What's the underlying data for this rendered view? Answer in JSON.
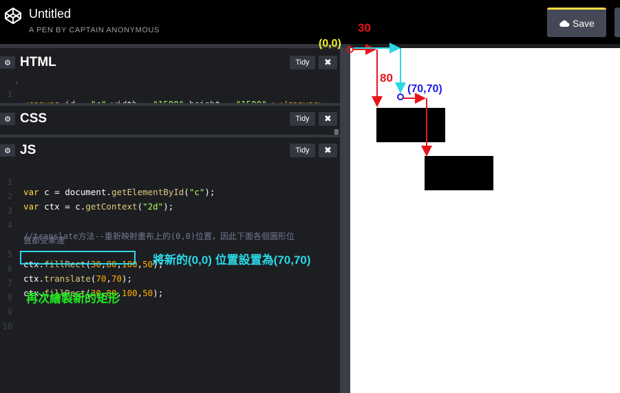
{
  "header": {
    "title": "Untitled",
    "subtitle": "A PEN BY CAPTAIN ANONYMOUS",
    "save_label": "Save",
    "logo_icon": "codepen-logo-icon",
    "save_icon": "cloud-icon"
  },
  "panels": {
    "html": {
      "name": "HTML",
      "tidy": "Tidy",
      "close": "✖"
    },
    "css": {
      "name": "CSS",
      "tidy": "Tidy",
      "close": "✖"
    },
    "js": {
      "name": "JS",
      "tidy": "Tidy",
      "close": "✖"
    }
  },
  "html_code": {
    "line_number": "1",
    "segments": [
      "<canvas ",
      "id",
      " = ",
      "\"c\"",
      " width",
      " = ",
      "\"1500\"",
      " height",
      " = ",
      "\"1500\"",
      " ></canvas>"
    ]
  },
  "js_code": {
    "line_numbers": [
      "1",
      "2",
      "3",
      "4",
      "5",
      "6",
      "7",
      "8",
      "9",
      "10"
    ],
    "line1": [
      "var",
      " c = document.",
      "getElementById",
      "(",
      "\"c\"",
      ");"
    ],
    "line2": [
      "var",
      " ctx = c.",
      "getContext",
      "(",
      "\"2d\"",
      ");"
    ],
    "line4a": "//translate方法--重新映射畫布上的(0,0)位置，因此下面各個圖形位",
    "line4b": "置都受牽連",
    "line5": [
      "ctx.",
      "fillRect",
      "(",
      "30",
      ",",
      "80",
      ",",
      "100",
      ",",
      "50",
      ");"
    ],
    "line6": [
      "ctx.",
      "translate",
      "(",
      "70",
      ",",
      "70",
      ");"
    ],
    "line7": [
      "ctx.",
      "fillRect",
      "(",
      "30",
      ",",
      "80",
      ",",
      "100",
      ",",
      "50",
      ");"
    ]
  },
  "annotations": {
    "translate_note": "將新的(0,0) 位置設置為(70,70)",
    "redraw_note": "再次繪製新的矩形",
    "origin_label": "(0,0)",
    "new_origin_label": "(70,70)",
    "x_offset_label": "30",
    "y_offset_label": "80"
  },
  "colors": {
    "accent_yellow": "#ffdd40",
    "highlight_cyan": "#2ad8e6",
    "annot_red": "#e8141c",
    "annot_blue": "#1a1ae6",
    "annot_green": "#22e822"
  }
}
